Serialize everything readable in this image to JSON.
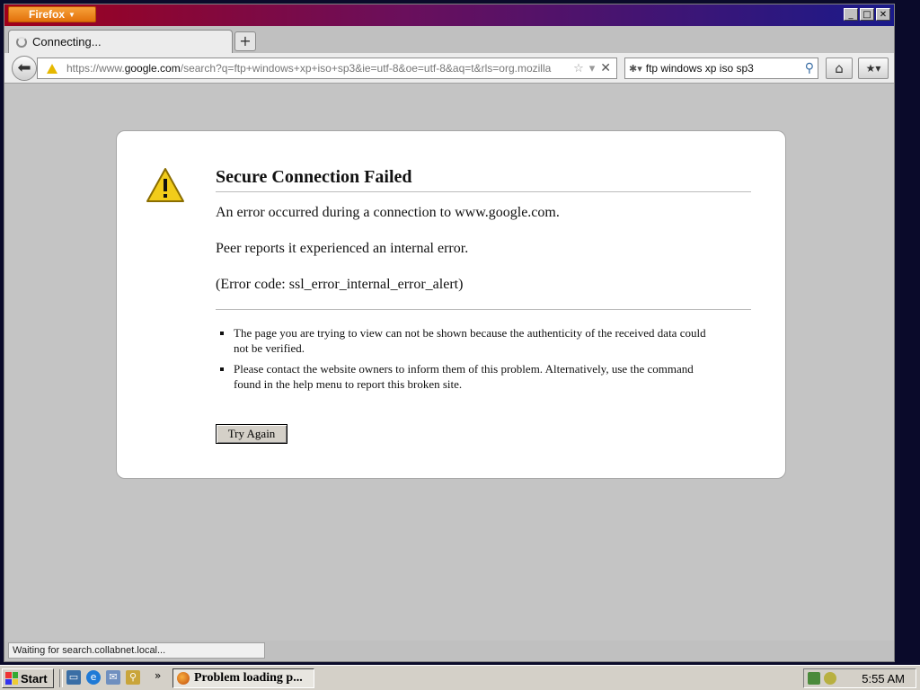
{
  "window": {
    "app_menu_label": "Firefox",
    "controls": [
      "_",
      "□",
      "✕"
    ]
  },
  "tab": {
    "title": "Connecting...",
    "new_tab_label": "+"
  },
  "nav": {
    "url_prefix": "https://www.",
    "url_domain": "google.com",
    "url_rest": "/search?q=ftp+windows+xp+iso+sp3&ie=utf-8&oe=utf-8&aq=t&rls=org.mozilla",
    "search_value": "ftp windows xp iso sp3"
  },
  "error": {
    "title": "Secure Connection Failed",
    "line1": "An error occurred during a connection to www.google.com.",
    "line2": "Peer reports it experienced an internal error.",
    "line3": "(Error code: ssl_error_internal_error_alert)",
    "bullets": [
      "The page you are trying to view can not be shown because the authenticity of the received data could not be verified.",
      "Please contact the website owners to inform them of this problem. Alternatively, use the command found in the help menu to report this broken site."
    ],
    "try_again_label": "Try Again"
  },
  "status": {
    "text": "Waiting for search.collabnet.local..."
  },
  "taskbar": {
    "start_label": "Start",
    "overflow": "»",
    "task_label": "Problem loading p...",
    "clock": "5:55 AM"
  },
  "colors": {
    "title_gradient_start": "#a0001a",
    "title_gradient_end": "#1a1a8a",
    "firefox_orange": "#e2700a",
    "warning_yellow": "#e6b800",
    "content_bg": "#c4c4c4"
  },
  "icons": [
    "spinner-icon",
    "back-arrow-icon",
    "warning-icon",
    "star-icon",
    "dropdown-icon",
    "stop-icon",
    "search-engine-icon",
    "magnifier-icon",
    "home-icon",
    "bookmarks-icon",
    "windows-logo-icon",
    "firefox-icon"
  ]
}
